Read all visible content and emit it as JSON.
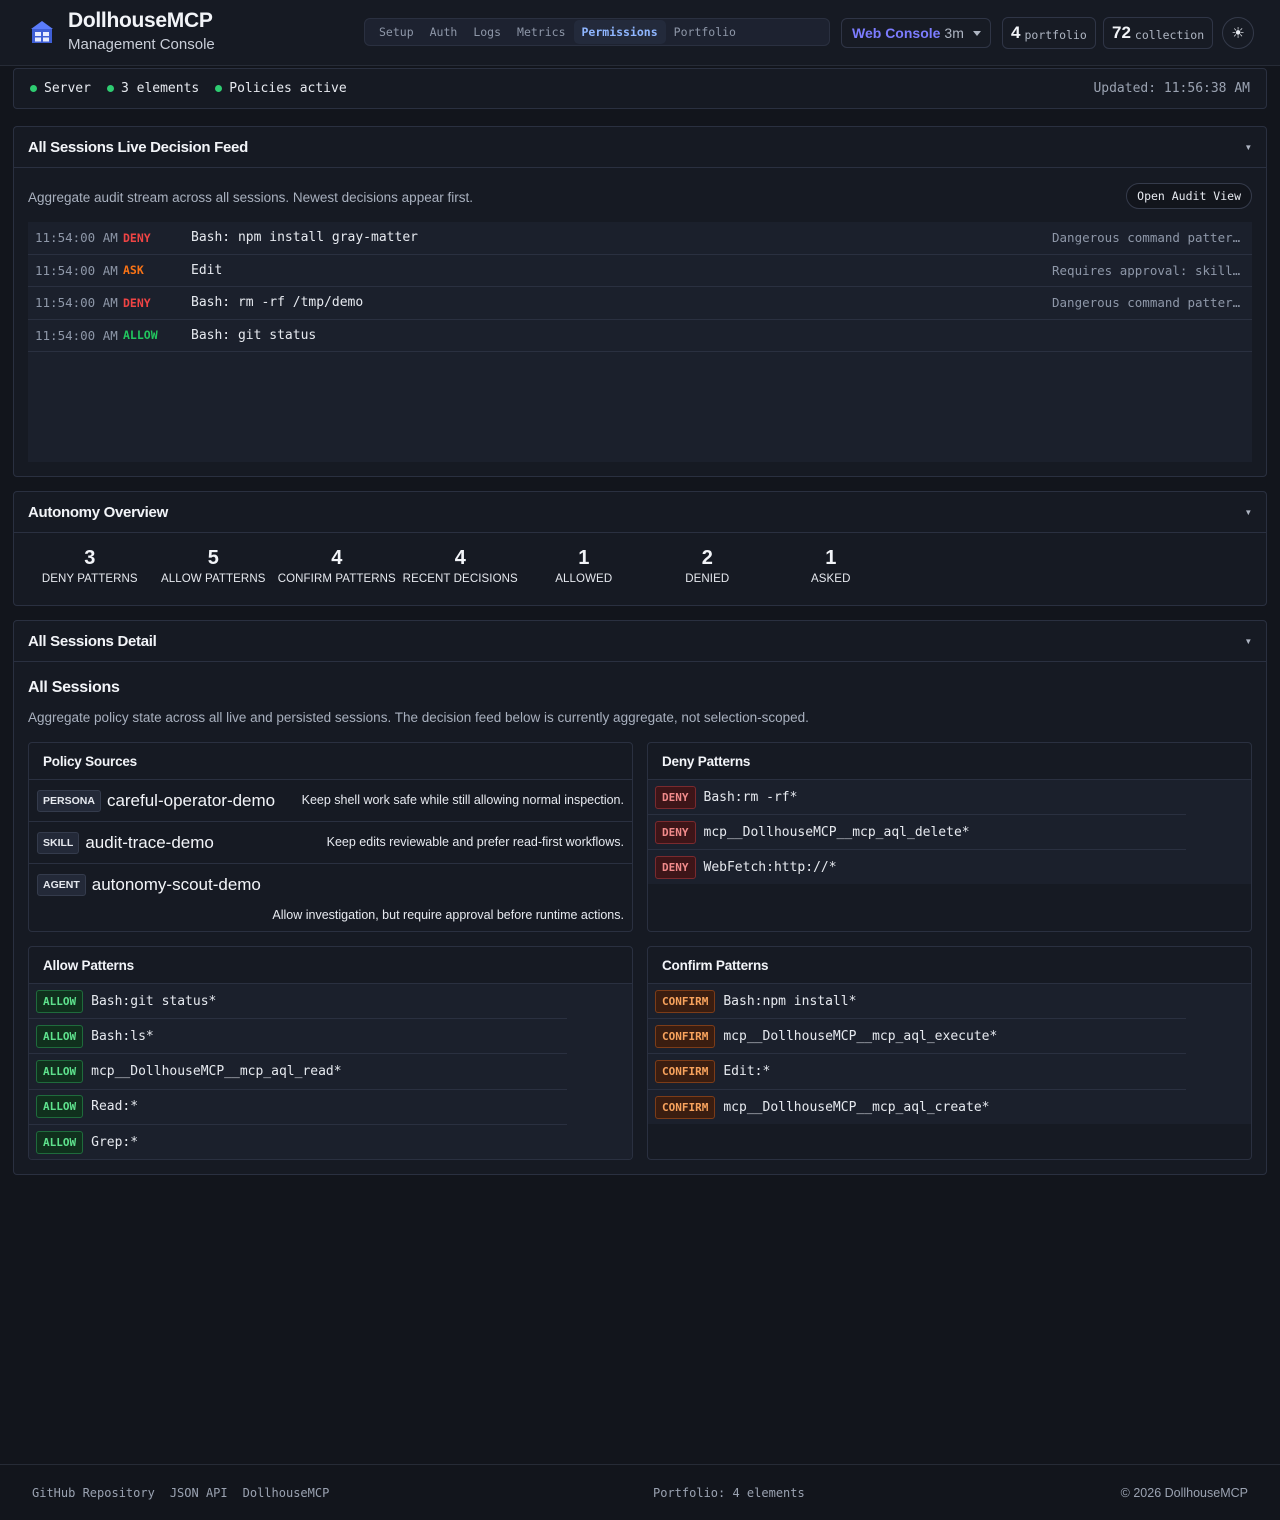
{
  "header": {
    "title": "DollhouseMCP",
    "subtitle": "Management Console",
    "tabs": [
      {
        "label": "Setup"
      },
      {
        "label": "Auth"
      },
      {
        "label": "Logs"
      },
      {
        "label": "Metrics"
      },
      {
        "label": "Permissions",
        "active": true
      },
      {
        "label": "Portfolio"
      }
    ],
    "console": {
      "name": "Web Console",
      "age": "3m"
    },
    "portfolio_count": "4",
    "portfolio_label": "portfolio",
    "collection_count": "72",
    "collection_label": "collection",
    "theme_icon": "sun-icon"
  },
  "status": {
    "server": "Server",
    "elements": "3 elements",
    "policies": "Policies active",
    "updated": "Updated: 11:56:38 AM"
  },
  "feed_panel": {
    "title": "All Sessions Live Decision Feed",
    "description": "Aggregate audit stream across all sessions. Newest decisions appear first.",
    "button": "Open Audit View",
    "rows": [
      {
        "time": "11:54:00 AM",
        "decision": "DENY",
        "command": "Bash: npm install gray-matter",
        "reason": "Dangerous command pattern:…"
      },
      {
        "time": "11:54:00 AM",
        "decision": "ASK",
        "command": "Edit",
        "reason": "Requires approval: skill '…"
      },
      {
        "time": "11:54:00 AM",
        "decision": "DENY",
        "command": "Bash: rm -rf /tmp/demo",
        "reason": "Dangerous command pattern:…"
      },
      {
        "time": "11:54:00 AM",
        "decision": "ALLOW",
        "command": "Bash: git status",
        "reason": ""
      }
    ]
  },
  "autonomy": {
    "title": "Autonomy Overview",
    "kpis": [
      {
        "value": "3",
        "label": "DENY PATTERNS"
      },
      {
        "value": "5",
        "label": "ALLOW PATTERNS"
      },
      {
        "value": "4",
        "label": "CONFIRM PATTERNS"
      },
      {
        "value": "4",
        "label": "RECENT DECISIONS"
      },
      {
        "value": "1",
        "label": "ALLOWED"
      },
      {
        "value": "2",
        "label": "DENIED"
      },
      {
        "value": "1",
        "label": "ASKED"
      }
    ]
  },
  "detail": {
    "title": "All Sessions Detail",
    "subtitle": "All Sessions",
    "description": "Aggregate policy state across all live and persisted sessions. The decision feed below is currently aggregate, not selection-scoped.",
    "policy_sources": {
      "title": "Policy Sources",
      "items": [
        {
          "type": "PERSONA",
          "name": "careful-operator-demo",
          "desc": "Keep shell work safe while still allowing normal inspection."
        },
        {
          "type": "SKILL",
          "name": "audit-trace-demo",
          "desc": "Keep edits reviewable and prefer read-first workflows."
        },
        {
          "type": "AGENT",
          "name": "autonomy-scout-demo",
          "desc": "Allow investigation, but require approval before runtime actions."
        }
      ]
    },
    "deny_patterns": {
      "title": "Deny Patterns",
      "badge": "DENY",
      "items": [
        "Bash:rm -rf*",
        "mcp__DollhouseMCP__mcp_aql_delete*",
        "WebFetch:http://*"
      ]
    },
    "allow_patterns": {
      "title": "Allow Patterns",
      "badge": "ALLOW",
      "items": [
        "Bash:git status*",
        "Bash:ls*",
        "mcp__DollhouseMCP__mcp_aql_read*",
        "Read:*",
        "Grep:*"
      ]
    },
    "confirm_patterns": {
      "title": "Confirm Patterns",
      "badge": "CONFIRM",
      "items": [
        "Bash:npm install*",
        "mcp__DollhouseMCP__mcp_aql_execute*",
        "Edit:*",
        "mcp__DollhouseMCP__mcp_aql_create*"
      ]
    }
  },
  "footer": {
    "links": [
      "GitHub Repository",
      "JSON API",
      "DollhouseMCP"
    ],
    "portfolio": "Portfolio: 4 elements",
    "copyright": "© 2026 DollhouseMCP"
  },
  "colors": {
    "background": "#12151c",
    "accent": "#8fb6ff",
    "deny": "#ef4444",
    "ask": "#f97316",
    "allow": "#22c55e"
  }
}
